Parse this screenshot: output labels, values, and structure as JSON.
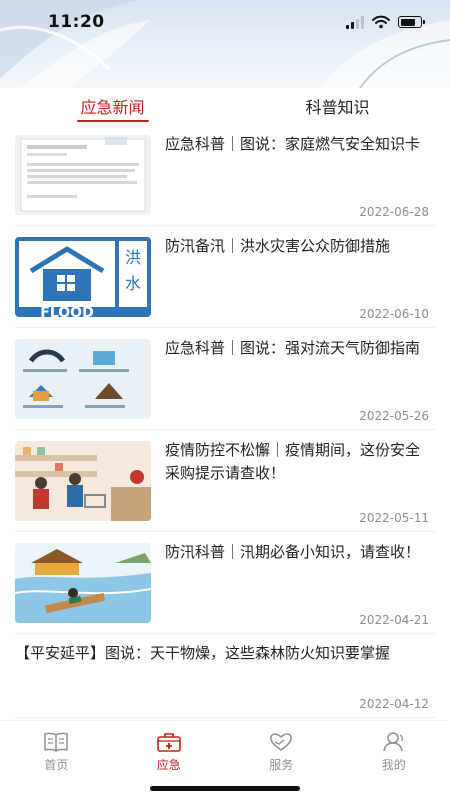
{
  "status_bar": {
    "time": "11:20",
    "battery_level": 0.75
  },
  "tabs": [
    {
      "label": "应急新闻",
      "active": true
    },
    {
      "label": "科普知识",
      "active": false
    }
  ],
  "news": [
    {
      "title": "应急科普｜图说：家庭燃气安全知识卡",
      "date": "2022-06-28",
      "thumb": "gas-safety-card"
    },
    {
      "title": "防汛备汛｜洪水灾害公众防御措施",
      "date": "2022-06-10",
      "thumb": "flood-poster"
    },
    {
      "title": "应急科普｜图说：强对流天气防御指南",
      "date": "2022-05-26",
      "thumb": "severe-weather-guide"
    },
    {
      "title": "疫情防控不松懈｜疫情期间，这份安全采购提示请查收！",
      "date": "2022-05-11",
      "thumb": "shopping-illustration"
    },
    {
      "title": "防汛科普｜汛期必备小知识，请查收！",
      "date": "2022-04-21",
      "thumb": "flood-rescue-illustration"
    },
    {
      "title": "【平安延平】图说：天干物燥，这些森林防火知识要掌握",
      "date": "2022-04-12",
      "thumb": ""
    }
  ],
  "thumb_texts": {
    "flood_cn_1": "洪",
    "flood_cn_2": "水",
    "flood_en": "FLOOD"
  },
  "bottom_nav": [
    {
      "label": "首页",
      "icon": "book-icon",
      "active": false
    },
    {
      "label": "应急",
      "icon": "first-aid-kit-icon",
      "active": true
    },
    {
      "label": "服务",
      "icon": "heart-hands-icon",
      "active": false
    },
    {
      "label": "我的",
      "icon": "user-icon",
      "active": false
    }
  ],
  "colors": {
    "accent": "#c0231c",
    "muted": "#8c8c8c"
  }
}
